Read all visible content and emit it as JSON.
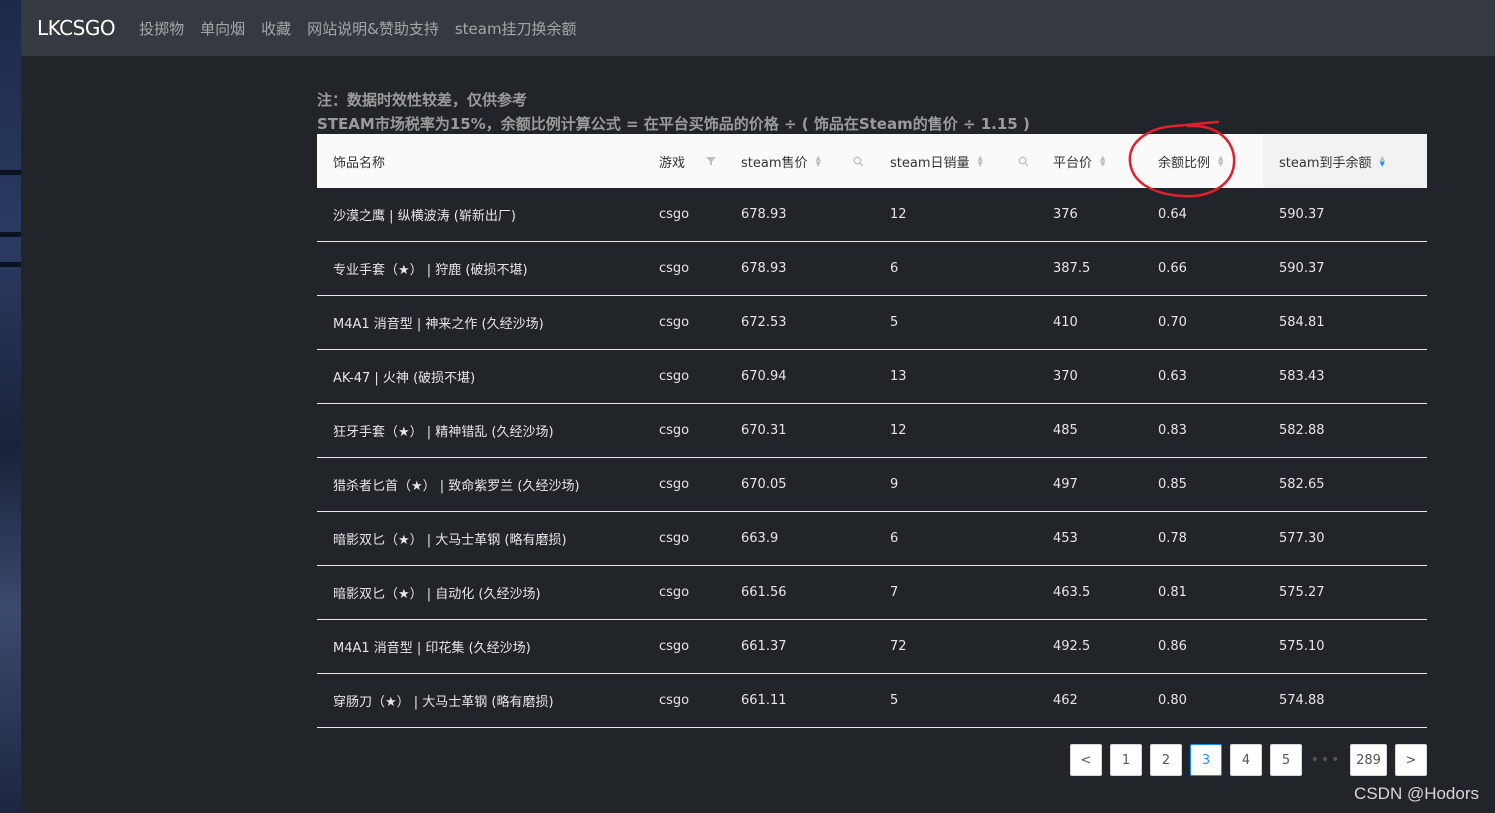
{
  "navbar": {
    "brand": "LKCSGO",
    "links": [
      "投掷物",
      "单向烟",
      "收藏",
      "网站说明&赞助支持",
      "steam挂刀换余额"
    ]
  },
  "notes": {
    "line1": "注：数据时效性较差，仅供参考",
    "line2": "STEAM市场税率为15%，余额比例计算公式 = 在平台买饰品的价格 ÷ ( 饰品在Steam的售价 ÷ 1.15 )"
  },
  "table": {
    "columns": [
      "饰品名称",
      "游戏",
      "steam售价",
      "steam日销量",
      "平台价",
      "余额比例",
      "steam到手余额"
    ],
    "rows": [
      [
        "沙漠之鹰 | 纵横波涛 (崭新出厂)",
        "csgo",
        "678.93",
        "12",
        "376",
        "0.64",
        "590.37"
      ],
      [
        "专业手套（★） | 狩鹿 (破损不堪)",
        "csgo",
        "678.93",
        "6",
        "387.5",
        "0.66",
        "590.37"
      ],
      [
        "M4A1 消音型 | 神来之作 (久经沙场)",
        "csgo",
        "672.53",
        "5",
        "410",
        "0.70",
        "584.81"
      ],
      [
        "AK-47 | 火神 (破损不堪)",
        "csgo",
        "670.94",
        "13",
        "370",
        "0.63",
        "583.43"
      ],
      [
        "狂牙手套（★） | 精神错乱 (久经沙场)",
        "csgo",
        "670.31",
        "12",
        "485",
        "0.83",
        "582.88"
      ],
      [
        "猎杀者匕首（★） | 致命紫罗兰 (久经沙场)",
        "csgo",
        "670.05",
        "9",
        "497",
        "0.85",
        "582.65"
      ],
      [
        "暗影双匕（★） | 大马士革钢 (略有磨损)",
        "csgo",
        "663.9",
        "6",
        "453",
        "0.78",
        "577.30"
      ],
      [
        "暗影双匕（★） | 自动化 (久经沙场)",
        "csgo",
        "661.56",
        "7",
        "463.5",
        "0.81",
        "575.27"
      ],
      [
        "M4A1 消音型 | 印花集 (久经沙场)",
        "csgo",
        "661.37",
        "72",
        "492.5",
        "0.86",
        "575.10"
      ],
      [
        "穿肠刀（★） | 大马士革钢 (略有磨损)",
        "csgo",
        "661.11",
        "5",
        "462",
        "0.80",
        "574.88"
      ]
    ]
  },
  "pagination": {
    "prev": "<",
    "pages": [
      "1",
      "2",
      "3",
      "4",
      "5"
    ],
    "current": "3",
    "ellipsis": "•••",
    "last": "289",
    "next": ">"
  },
  "watermark": "CSDN @Hodors",
  "colors": {
    "accent": "#1890ff",
    "annotation": "#e0202a",
    "navbar": "#343a40",
    "background": "#212429"
  }
}
